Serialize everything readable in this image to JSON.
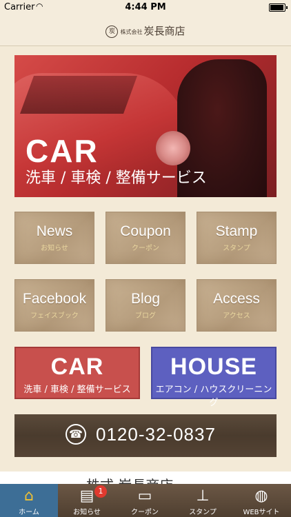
{
  "status_bar": {
    "carrier": "Carrier",
    "time": "4:44 PM"
  },
  "nav": {
    "logo_mark": "炭",
    "logo_small": "株式会社",
    "logo_text": "炭長商店"
  },
  "hero": {
    "title": "CAR",
    "subtitle": "洗車 / 車検 / 整備サービス"
  },
  "tiles": [
    {
      "title": "News",
      "sub": "お知らせ"
    },
    {
      "title": "Coupon",
      "sub": "クーポン"
    },
    {
      "title": "Stamp",
      "sub": "スタンプ"
    },
    {
      "title": "Facebook",
      "sub": "フェイスブック"
    },
    {
      "title": "Blog",
      "sub": "ブログ"
    },
    {
      "title": "Access",
      "sub": "アクセス"
    }
  ],
  "big_buttons": {
    "car": {
      "title": "CAR",
      "sub": "洗車 / 車検 / 整備サービス",
      "color": "#c8504d"
    },
    "house": {
      "title": "HOUSE",
      "sub": "エアコン / ハウスクリーニング",
      "color": "#5d60c0"
    }
  },
  "phone": {
    "number": "0120-32-0837"
  },
  "footer": {
    "logo_text": "株式 炭長商店"
  },
  "tabs": [
    {
      "label": "ホーム",
      "icon": "home-icon"
    },
    {
      "label": "お知らせ",
      "icon": "news-icon",
      "badge": "1"
    },
    {
      "label": "クーポン",
      "icon": "coupon-icon"
    },
    {
      "label": "スタンプ",
      "icon": "stamp-icon"
    },
    {
      "label": "WEBサイト",
      "icon": "globe-icon"
    }
  ],
  "colors": {
    "tab_active": "#3d6e96",
    "badge": "#e03a2f"
  }
}
